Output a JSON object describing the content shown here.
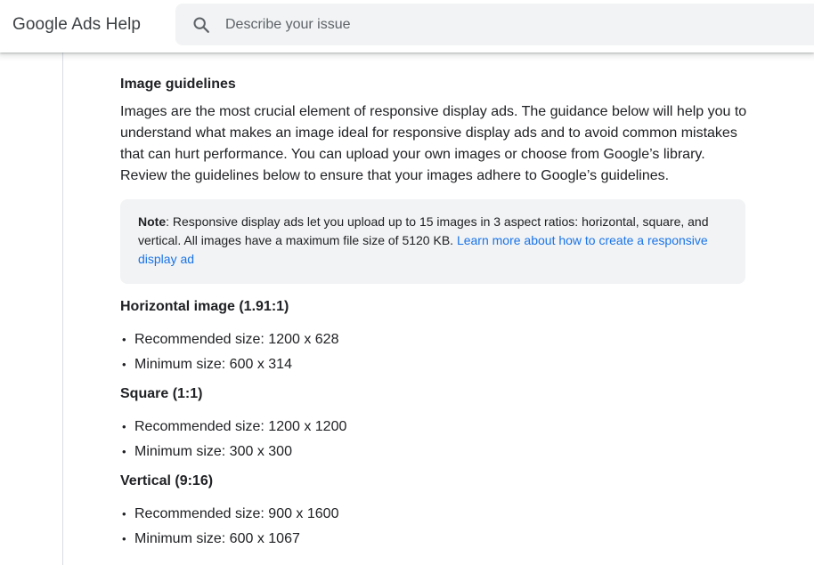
{
  "header": {
    "brand": "Google Ads Help",
    "search_placeholder": "Describe your issue",
    "search_value": ""
  },
  "article": {
    "title": "Image guidelines",
    "intro": "Images are the most crucial element of responsive display ads. The guidance below will help you to understand what makes an image ideal for responsive display ads and to avoid common mistakes that can hurt performance. You can upload your own images or choose from Google’s library. Review the guidelines below to ensure that your images adhere to Google’s guidelines.",
    "note": {
      "label": "Note",
      "text": ": Responsive display ads let you upload up to 15 images in 3 aspect ratios: horizontal, square, and vertical. All images have a maximum file size of 5120 KB. ",
      "link": "Learn more about how to create a responsive display ad"
    },
    "groups": [
      {
        "title": "Horizontal image (1.91:1)",
        "items": [
          "Recommended size: 1200 x 628",
          "Minimum size: 600 x 314"
        ]
      },
      {
        "title": "Square (1:1)",
        "items": [
          "Recommended size: 1200 x 1200",
          "Minimum size: 300 x 300"
        ]
      },
      {
        "title": "Vertical (9:16)",
        "items": [
          "Recommended size: 900 x 1600",
          "Minimum size: 600 x 1067"
        ]
      }
    ]
  },
  "colors": {
    "link": "#1a73e8",
    "note_background": "#f1f3f4",
    "text": "#202124"
  },
  "icons": {
    "search": "search-icon"
  }
}
